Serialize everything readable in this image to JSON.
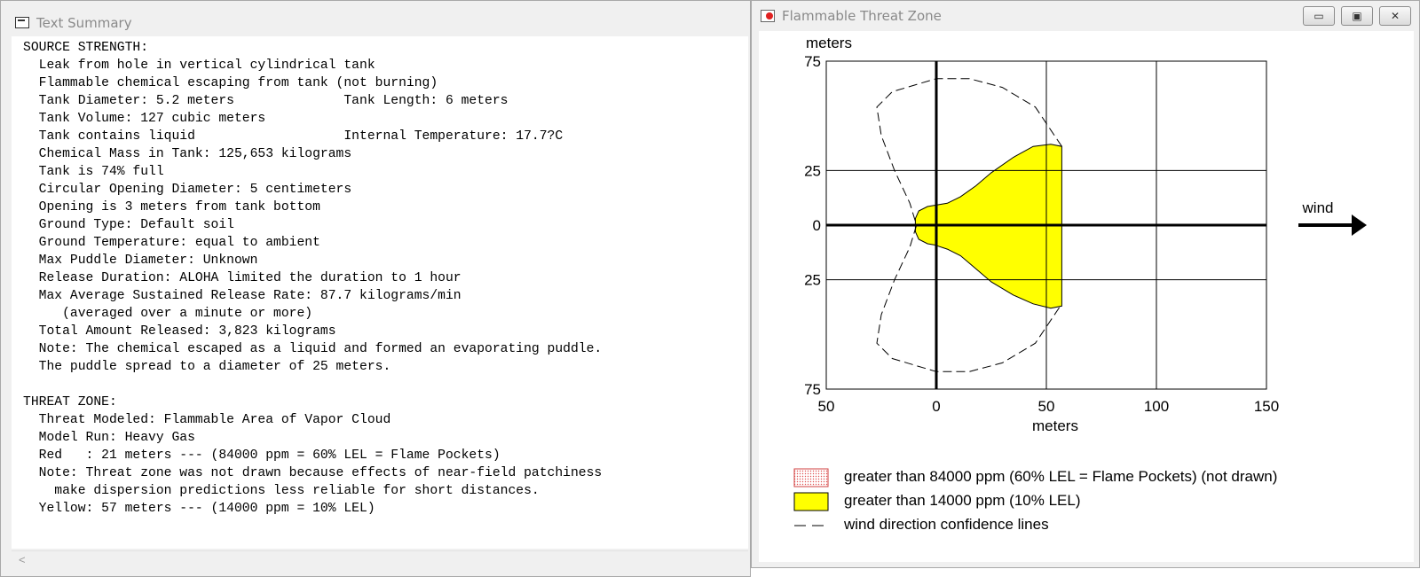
{
  "left_window": {
    "title": "Text Summary",
    "summary_lines": [
      "SOURCE STRENGTH:",
      "  Leak from hole in vertical cylindrical tank",
      "  Flammable chemical escaping from tank (not burning)",
      "  Tank Diameter: 5.2 meters              Tank Length: 6 meters",
      "  Tank Volume: 127 cubic meters",
      "  Tank contains liquid                   Internal Temperature: 17.7?C",
      "  Chemical Mass in Tank: 125,653 kilograms",
      "  Tank is 74% full",
      "  Circular Opening Diameter: 5 centimeters",
      "  Opening is 3 meters from tank bottom",
      "  Ground Type: Default soil",
      "  Ground Temperature: equal to ambient",
      "  Max Puddle Diameter: Unknown",
      "  Release Duration: ALOHA limited the duration to 1 hour",
      "  Max Average Sustained Release Rate: 87.7 kilograms/min",
      "     (averaged over a minute or more)",
      "  Total Amount Released: 3,823 kilograms",
      "  Note: The chemical escaped as a liquid and formed an evaporating puddle.",
      "  The puddle spread to a diameter of 25 meters.",
      "",
      "THREAT ZONE:",
      "  Threat Modeled: Flammable Area of Vapor Cloud",
      "  Model Run: Heavy Gas",
      "  Red   : 21 meters --- (84000 ppm = 60% LEL = Flame Pockets)",
      "  Note: Threat zone was not drawn because effects of near-field patchiness",
      "    make dispersion predictions less reliable for short distances.",
      "  Yellow: 57 meters --- (14000 ppm = 10% LEL)"
    ],
    "scroll_left_glyph": "<"
  },
  "right_window": {
    "title": "Flammable Threat Zone",
    "controls": {
      "minimize": "▭",
      "maximize": "▣",
      "close": "✕"
    }
  },
  "chart_data": {
    "type": "area",
    "x_unit_label": "meters",
    "y_unit_label": "meters",
    "xlim": [
      -50,
      150
    ],
    "ylim": [
      -75,
      75
    ],
    "x_ticks": [
      -50,
      0,
      50,
      100,
      150
    ],
    "x_tick_labels": [
      "50",
      "0",
      "50",
      "100",
      "150"
    ],
    "y_ticks": [
      75,
      25,
      0,
      -25,
      -75
    ],
    "y_tick_labels": [
      "75",
      "25",
      "0",
      "25",
      "75"
    ],
    "grid": true,
    "wind_label": "wind",
    "colors": {
      "yellow_zone": "#ffff00",
      "red_zone": "#ff0000",
      "axis": "#000000"
    },
    "series": [
      {
        "name": "greater than 14000 ppm (10% LEL)",
        "color": "#ffff00",
        "x": [
          -1,
          -4,
          -8,
          -9.5,
          -9.5,
          -8,
          -4,
          -1,
          5,
          11,
          18,
          25,
          35,
          44,
          52,
          57,
          57,
          52,
          44,
          35,
          25,
          18,
          11,
          5,
          -1
        ],
        "y": [
          9,
          8.5,
          6.5,
          3,
          -3,
          -6.5,
          -8.5,
          -9,
          -11,
          -14,
          -20,
          -26,
          -32,
          -36,
          -38,
          -37,
          36,
          37,
          36,
          31,
          24,
          18,
          13,
          10,
          9
        ]
      }
    ],
    "confidence_lines": {
      "upper": {
        "x": [
          57,
          45,
          30,
          15,
          0,
          -20,
          -27,
          -25,
          -19,
          -12,
          -9
        ],
        "y": [
          36,
          54,
          63,
          67,
          67,
          61,
          54,
          41,
          25,
          10,
          0
        ]
      },
      "lower": {
        "x": [
          -9,
          -12,
          -19,
          -25,
          -27,
          -20,
          0,
          15,
          30,
          45,
          57
        ],
        "y": [
          0,
          -10,
          -25,
          -41,
          -54,
          -61,
          -67,
          -67,
          -63,
          -54,
          -36
        ]
      }
    },
    "legend": [
      {
        "label": "greater than 84000 ppm (60% LEL = Flame Pockets) (not drawn)",
        "swatch": "red-dotted"
      },
      {
        "label": "greater than 14000 ppm (10% LEL)",
        "swatch": "yellow"
      },
      {
        "label": "wind direction confidence lines",
        "swatch": "dashed-line"
      }
    ]
  }
}
